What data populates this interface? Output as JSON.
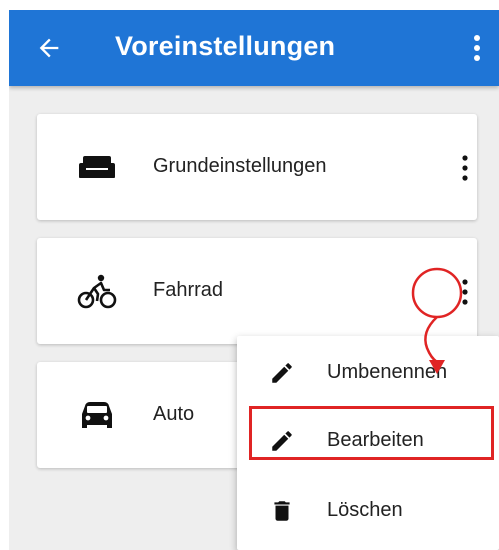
{
  "appbar": {
    "title": "Voreinstellungen",
    "back_icon": "arrow-back-icon",
    "overflow_icon": "more-vert-icon",
    "color": "#1f75d6"
  },
  "profiles": [
    {
      "label": "Grundeinstellungen",
      "icon": "sofa-icon"
    },
    {
      "label": "Fahrrad",
      "icon": "bicycle-icon"
    },
    {
      "label": "Auto",
      "icon": "car-icon"
    }
  ],
  "context_menu": {
    "items": [
      {
        "label": "Umbenennen",
        "icon": "pencil-icon"
      },
      {
        "label": "Bearbeiten",
        "icon": "pencil-icon",
        "highlighted": true
      },
      {
        "label": "Löschen",
        "icon": "trash-icon"
      }
    ]
  },
  "annotation": {
    "color": "#e02424"
  }
}
